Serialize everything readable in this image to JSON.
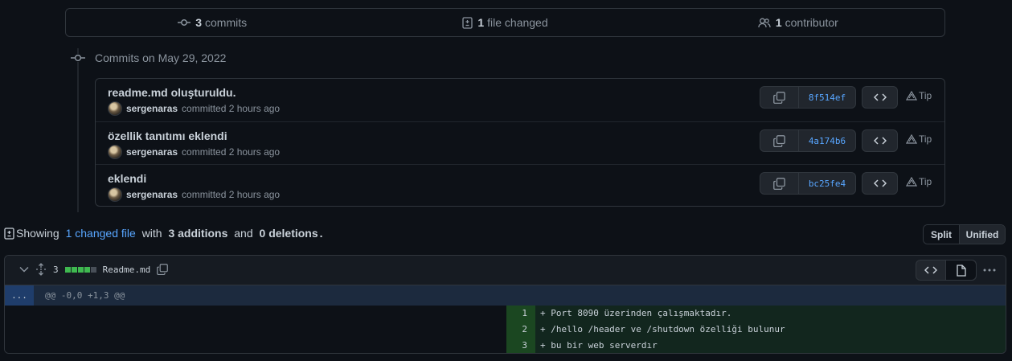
{
  "summary": {
    "commits_count": "3",
    "commits_label": "commits",
    "files_count": "1",
    "files_label": "file changed",
    "contributors_count": "1",
    "contributors_label": "contributor"
  },
  "timeline": {
    "heading": "Commits on May 29, 2022"
  },
  "commits": [
    {
      "title": "readme.md oluşturuldu.",
      "author": "sergenaras",
      "meta": "committed 2 hours ago",
      "sha": "8f514ef",
      "tip": "Tip"
    },
    {
      "title": "özellik tanıtımı eklendi",
      "author": "sergenaras",
      "meta": "committed 2 hours ago",
      "sha": "4a174b6",
      "tip": "Tip"
    },
    {
      "title": "eklendi",
      "author": "sergenaras",
      "meta": "committed 2 hours ago",
      "sha": "bc25fe4",
      "tip": "Tip"
    }
  ],
  "showing": {
    "prefix": "Showing",
    "link": "1 changed file",
    "mid": "with",
    "additions": "3 additions",
    "and": "and",
    "deletions": "0 deletions",
    "suffix": "."
  },
  "view_toggle": {
    "split": "Split",
    "unified": "Unified"
  },
  "file": {
    "additions_count": "3",
    "name": "Readme.md",
    "hunk_expander": "...",
    "hunk_header": "@@ -0,0 +1,3 @@",
    "lines": [
      {
        "num": "1",
        "text": "+ Port 8090 üzerinden çalışmaktadır."
      },
      {
        "num": "2",
        "text": "+ /hello /header ve /shutdown özelliği bulunur"
      },
      {
        "num": "3",
        "text": "+ bu bir web serverdır"
      }
    ]
  },
  "colors": {
    "accent": "#58a6ff",
    "added_bg": "#12261e",
    "added_num_bg": "#1b4721",
    "diffstat_green": "#3fb950"
  }
}
